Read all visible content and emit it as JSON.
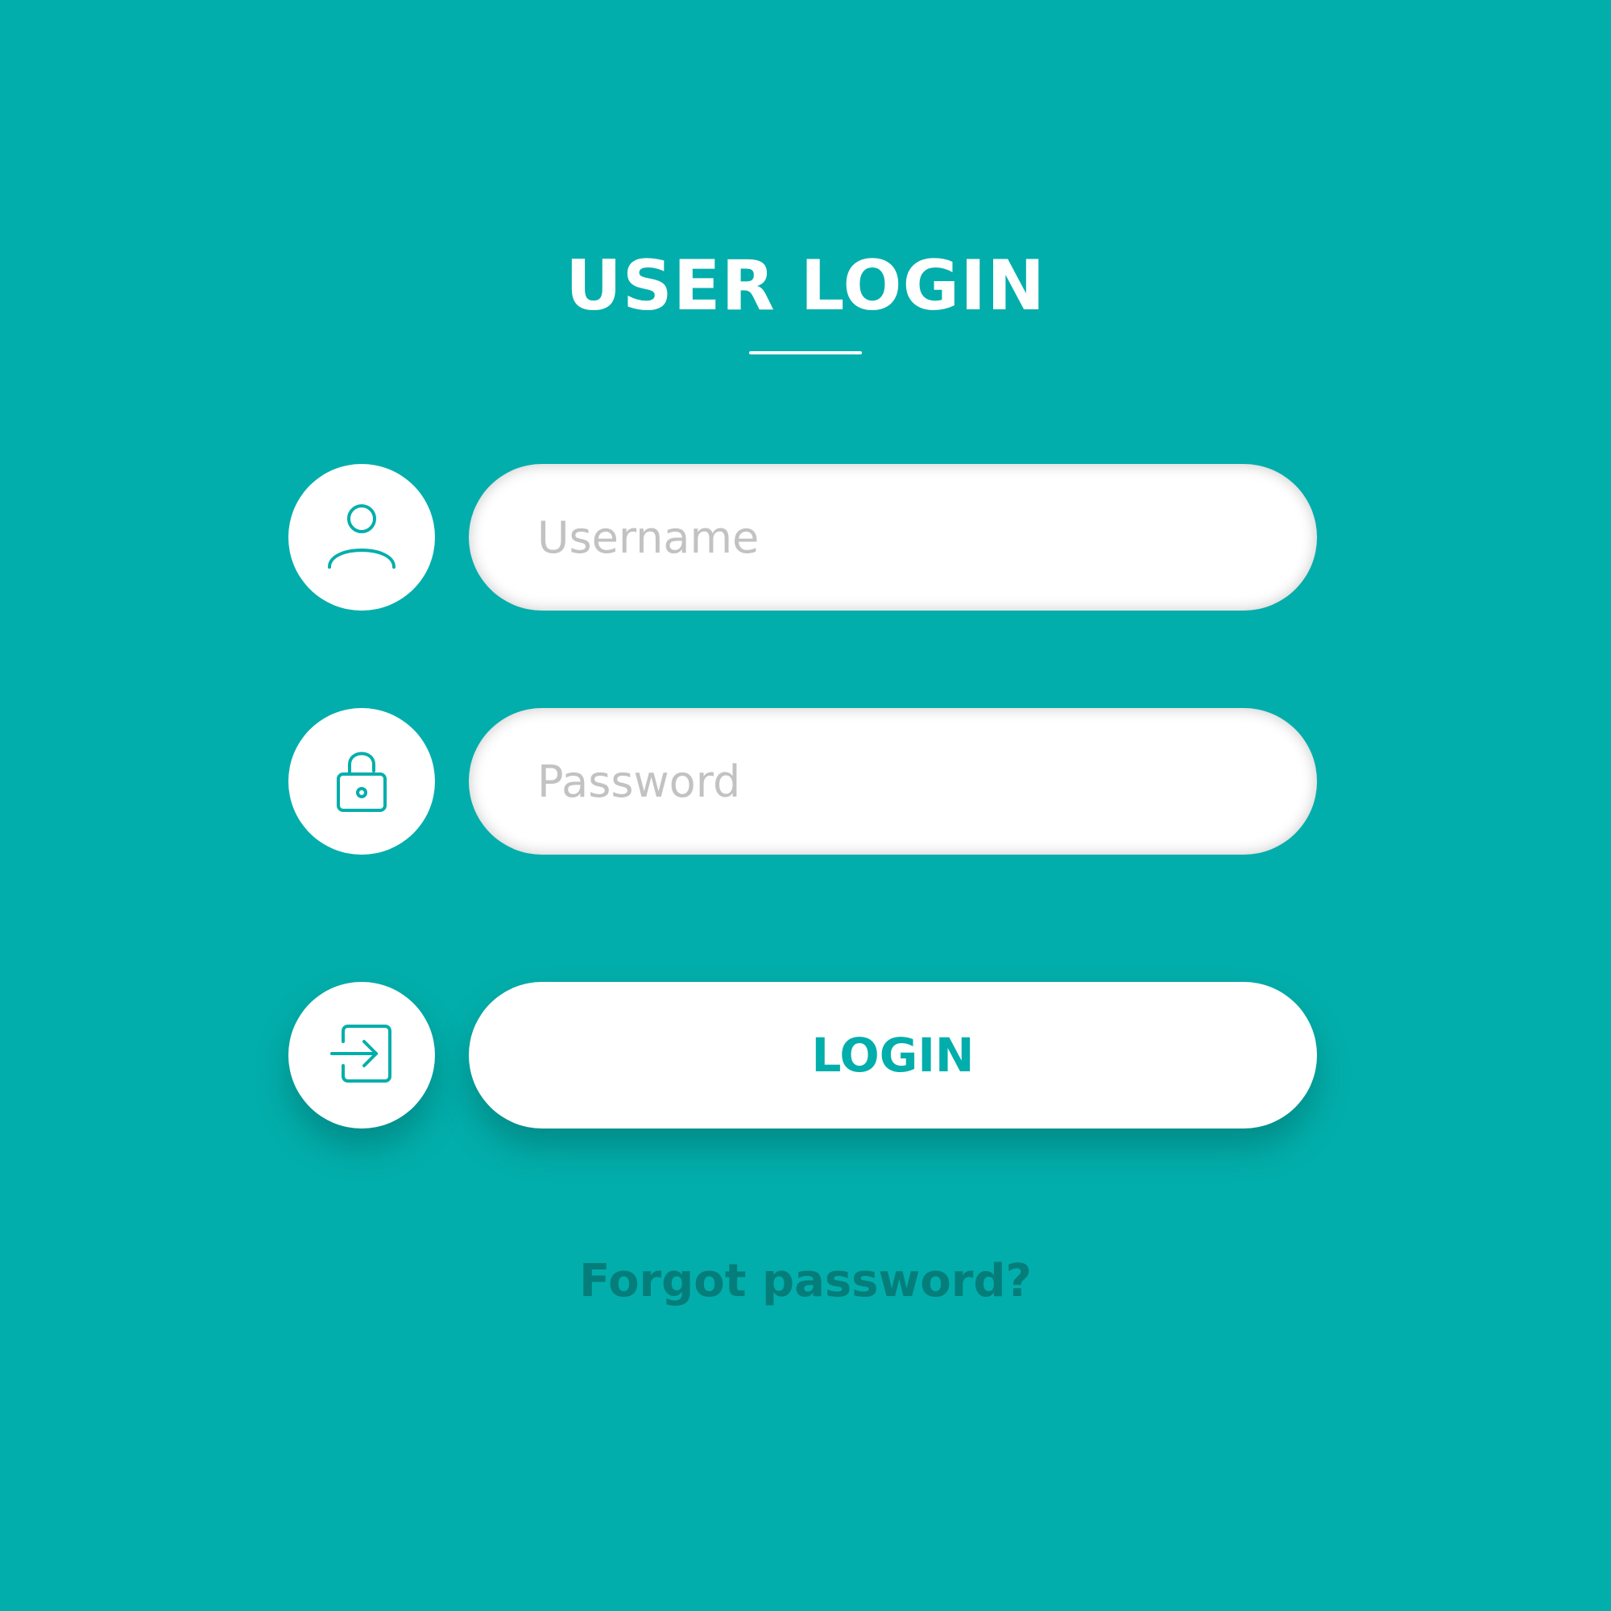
{
  "header": {
    "title": "USER LOGIN"
  },
  "form": {
    "username": {
      "icon": "user-icon",
      "placeholder": "Username",
      "value": ""
    },
    "password": {
      "icon": "unlocked-padlock-icon",
      "placeholder": "Password",
      "value": ""
    },
    "login": {
      "icon": "sign-in-arrow-icon",
      "label": "LOGIN"
    },
    "forgot_password_label": "Forgot password?"
  },
  "colors": {
    "background": "#02aeab",
    "accent": "#02aeab",
    "surface": "#ffffff",
    "placeholder": "#c2c2c2",
    "link": "#057e7b"
  }
}
